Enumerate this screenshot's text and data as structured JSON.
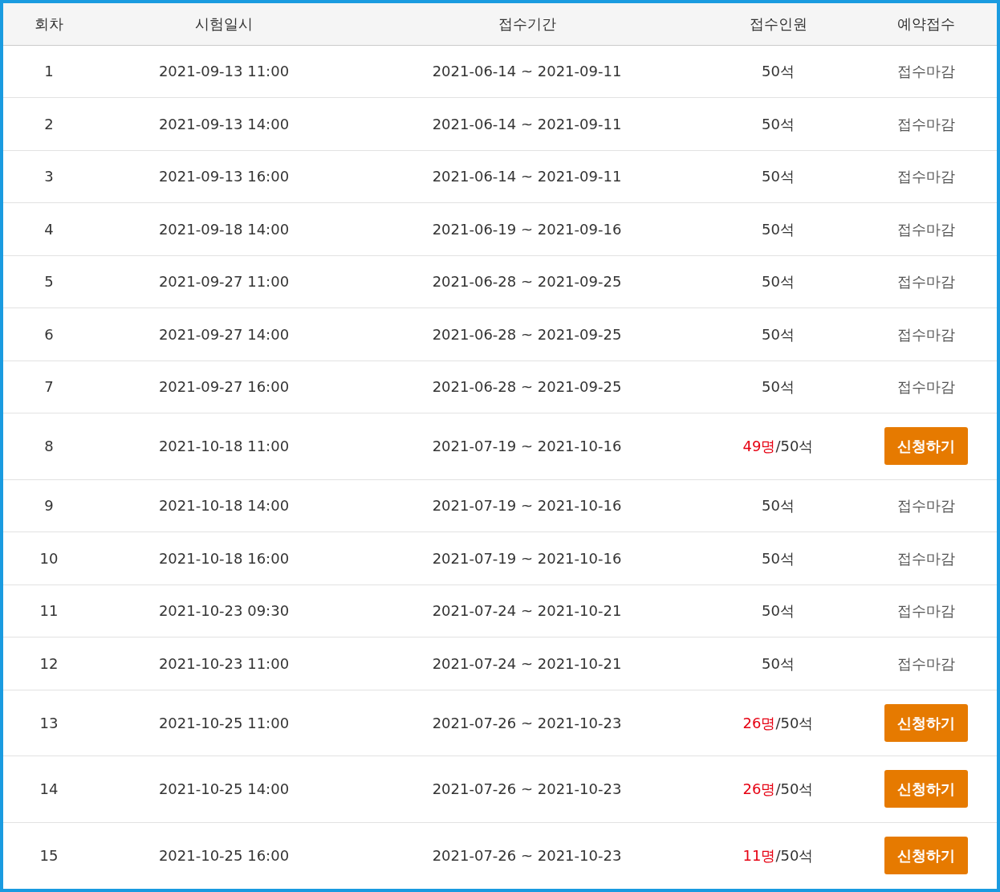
{
  "table": {
    "columns": [
      "회차",
      "시험일시",
      "접수기간",
      "접수인원",
      "예약접수"
    ],
    "rows": [
      {
        "round": "1",
        "datetime": "2021-09-13 11:00",
        "period": "2021-06-14 ~ 2021-09-11",
        "seats": "50석",
        "action": {
          "kind": "closed",
          "label": "접수마감"
        }
      },
      {
        "round": "2",
        "datetime": "2021-09-13 14:00",
        "period": "2021-06-14 ~ 2021-09-11",
        "seats": "50석",
        "action": {
          "kind": "closed",
          "label": "접수마감"
        }
      },
      {
        "round": "3",
        "datetime": "2021-09-13 16:00",
        "period": "2021-06-14 ~ 2021-09-11",
        "seats": "50석",
        "action": {
          "kind": "closed",
          "label": "접수마감"
        }
      },
      {
        "round": "4",
        "datetime": "2021-09-18 14:00",
        "period": "2021-06-19 ~ 2021-09-16",
        "seats": "50석",
        "action": {
          "kind": "closed",
          "label": "접수마감"
        }
      },
      {
        "round": "5",
        "datetime": "2021-09-27 11:00",
        "period": "2021-06-28 ~ 2021-09-25",
        "seats": "50석",
        "action": {
          "kind": "closed",
          "label": "접수마감"
        }
      },
      {
        "round": "6",
        "datetime": "2021-09-27 14:00",
        "period": "2021-06-28 ~ 2021-09-25",
        "seats": "50석",
        "action": {
          "kind": "closed",
          "label": "접수마감"
        }
      },
      {
        "round": "7",
        "datetime": "2021-09-27 16:00",
        "period": "2021-06-28 ~ 2021-09-25",
        "seats": "50석",
        "action": {
          "kind": "closed",
          "label": "접수마감"
        }
      },
      {
        "round": "8",
        "datetime": "2021-10-18 11:00",
        "period": "2021-07-19 ~ 2021-10-16",
        "applied": "49명",
        "seats": "/50석",
        "action": {
          "kind": "button",
          "label": "신청하기"
        }
      },
      {
        "round": "9",
        "datetime": "2021-10-18 14:00",
        "period": "2021-07-19 ~ 2021-10-16",
        "seats": "50석",
        "action": {
          "kind": "closed",
          "label": "접수마감"
        }
      },
      {
        "round": "10",
        "datetime": "2021-10-18 16:00",
        "period": "2021-07-19 ~ 2021-10-16",
        "seats": "50석",
        "action": {
          "kind": "closed",
          "label": "접수마감"
        }
      },
      {
        "round": "11",
        "datetime": "2021-10-23 09:30",
        "period": "2021-07-24 ~ 2021-10-21",
        "seats": "50석",
        "action": {
          "kind": "closed",
          "label": "접수마감"
        }
      },
      {
        "round": "12",
        "datetime": "2021-10-23 11:00",
        "period": "2021-07-24 ~ 2021-10-21",
        "seats": "50석",
        "action": {
          "kind": "closed",
          "label": "접수마감"
        }
      },
      {
        "round": "13",
        "datetime": "2021-10-25 11:00",
        "period": "2021-07-26 ~ 2021-10-23",
        "applied": "26명",
        "seats": "/50석",
        "action": {
          "kind": "button",
          "label": "신청하기"
        }
      },
      {
        "round": "14",
        "datetime": "2021-10-25 14:00",
        "period": "2021-07-26 ~ 2021-10-23",
        "applied": "26명",
        "seats": "/50석",
        "action": {
          "kind": "button",
          "label": "신청하기"
        }
      },
      {
        "round": "15",
        "datetime": "2021-10-25 16:00",
        "period": "2021-07-26 ~ 2021-10-23",
        "applied": "11명",
        "seats": "/50석",
        "action": {
          "kind": "button",
          "label": "신청하기"
        }
      }
    ]
  }
}
